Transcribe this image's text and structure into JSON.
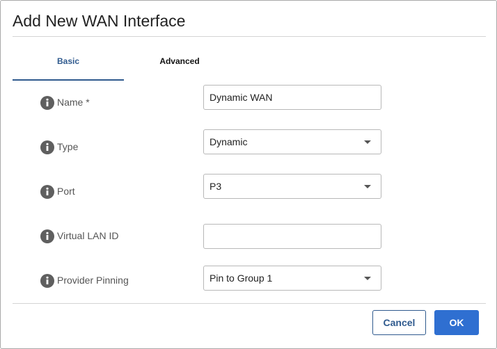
{
  "dialog": {
    "title": "Add New WAN Interface"
  },
  "tabs": [
    {
      "label": "Basic",
      "active": true
    },
    {
      "label": "Advanced",
      "active": false
    }
  ],
  "form": {
    "name": {
      "label": "Name *",
      "value": "Dynamic WAN"
    },
    "type": {
      "label": "Type",
      "value": "Dynamic"
    },
    "port": {
      "label": "Port",
      "value": "P3"
    },
    "vlan": {
      "label": "Virtual LAN ID",
      "value": ""
    },
    "provider_pinning": {
      "label": "Provider Pinning",
      "value": "Pin to Group 1"
    }
  },
  "footer": {
    "cancel_label": "Cancel",
    "ok_label": "OK"
  },
  "colors": {
    "accent": "#2f5a8e",
    "primary_button": "#2f6fd1",
    "info_icon": "#5f5f5f"
  }
}
